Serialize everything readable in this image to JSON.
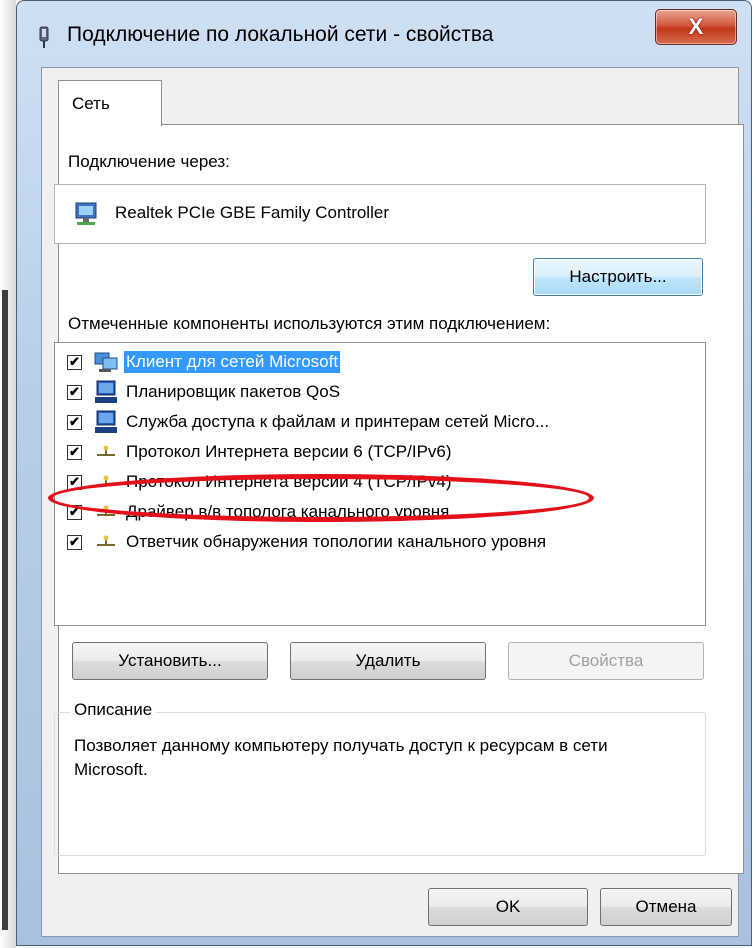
{
  "window": {
    "title": "Подключение по локальной сети - свойства",
    "close_label": "X"
  },
  "tabs": [
    {
      "label": "Сеть",
      "selected": true
    }
  ],
  "connect_via": {
    "label": "Подключение через:",
    "adapter": "Realtek PCIe GBE Family Controller",
    "configure_button": "Настроить..."
  },
  "components": {
    "label": "Отмеченные компоненты используются этим подключением:",
    "items": [
      {
        "label": "Клиент для сетей Microsoft",
        "checked": true,
        "icon": "network-client-icon",
        "selected": true
      },
      {
        "label": "Планировщик пакетов QoS",
        "checked": true,
        "icon": "computer-icon"
      },
      {
        "label": "Служба доступа к файлам и принтерам сетей Micro...",
        "checked": true,
        "icon": "computer-icon"
      },
      {
        "label": "Протокол Интернета версии 6 (TCP/IPv6)",
        "checked": true,
        "icon": "protocol-icon"
      },
      {
        "label": "Протокол Интернета версии 4 (TCP/IPv4)",
        "checked": true,
        "icon": "protocol-icon",
        "highlighted": true
      },
      {
        "label": "Драйвер в/в тополога канального уровня",
        "checked": true,
        "icon": "protocol-icon"
      },
      {
        "label": "Ответчик обнаружения топологии канального уровня",
        "checked": true,
        "icon": "protocol-icon"
      }
    ]
  },
  "buttons": {
    "install": "Установить...",
    "remove": "Удалить",
    "properties": "Свойства",
    "ok": "OK",
    "cancel": "Отмена"
  },
  "description": {
    "title": "Описание",
    "text": "Позволяет данному компьютеру получать доступ к ресурсам в сети Microsoft."
  },
  "colors": {
    "selection": "#3399ff",
    "annotation_ellipse": "#e3101a"
  }
}
